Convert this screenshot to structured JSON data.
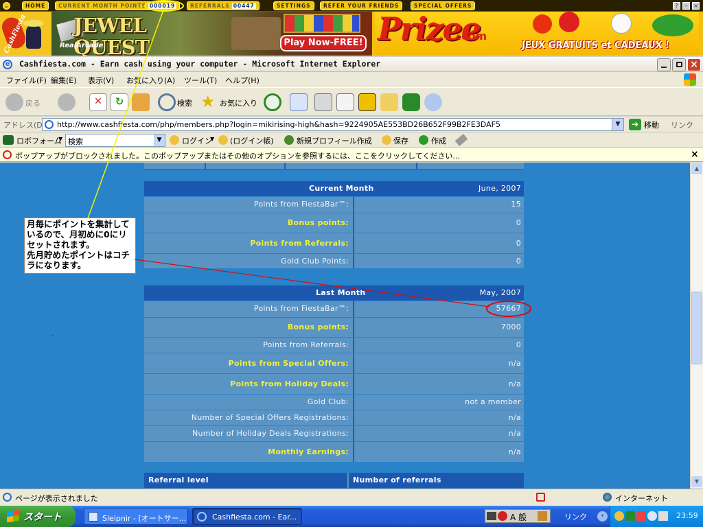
{
  "fiesta_bar": {
    "home": "HOME",
    "current_month_points_label": "CURRENT MONTH POINTS",
    "current_month_points_value": "000019",
    "referrals_label": "REFERRALS",
    "referrals_value": "00447",
    "settings": "SETTINGS",
    "refer_friends": "REFER YOUR FRIENDS",
    "special_offers": "SPECIAL OFFERS"
  },
  "ads": {
    "cashfiesta_logo": "CashFiesta",
    "jewel_quest": "JEWEL QUEST",
    "realarcade": "RealArcade",
    "play_now": "Play Now-FREE!",
    "prizee": "Prizee",
    "prizee_com": ".com",
    "prizee_tagline": "JEUX GRATUITS et CADEAUX !"
  },
  "browser": {
    "title": "Cashfiesta.com - Earn cash using your computer - Microsoft Internet Explorer",
    "menu": [
      "ファイル(F)",
      "編集(E)",
      "表示(V)",
      "お気に入り(A)",
      "ツール(T)",
      "ヘルプ(H)"
    ],
    "back": "戻る",
    "search": "検索",
    "favorites": "お気に入り",
    "address_label": "アドレス(D)",
    "url": "http://www.cashfiesta.com/php/members.php?login=mikirising-high&hash=9224905AE553BD26B652F99B2FE3DAF5",
    "go": "移動",
    "links": "リンク",
    "roboform": "ロボフォーム",
    "robo_search": "検索",
    "login": "ログイン",
    "login_book": "(ログイン帳)",
    "new_profile": "新規プロフィール作成",
    "save": "保存",
    "create": "作成",
    "popup_message": "ポップアップがブロックされました。このポップアップまたはその他のオプションを参照するには、ここをクリックしてください...",
    "status_text": "ページが表示されました",
    "zone": "インターネット"
  },
  "current_month": {
    "header": "Current Month",
    "date": "June, 2007",
    "rows": [
      {
        "label": "Points from FiestaBar™:",
        "value": "15"
      },
      {
        "label": "Bonus points:",
        "value": "0"
      },
      {
        "label": "Points from Referrals:",
        "value": "0"
      },
      {
        "label": "Gold Club Points:",
        "value": "0"
      }
    ]
  },
  "last_month": {
    "header": "Last Month",
    "date": "May, 2007",
    "rows": [
      {
        "label": "Points from FiestaBar™:",
        "value": "57667"
      },
      {
        "label": "Bonus points:",
        "value": "7000"
      },
      {
        "label": "Points from Referrals:",
        "value": "0"
      },
      {
        "label": "Points from Special Offers:",
        "value": "n/a"
      },
      {
        "label": "Points from Holiday Deals:",
        "value": "n/a"
      },
      {
        "label": "Gold Club:",
        "value": "not a member"
      },
      {
        "label": "Number of Special Offers Registrations:",
        "value": "n/a"
      },
      {
        "label": "Number of Holiday Deals Registrations:",
        "value": "n/a"
      },
      {
        "label": "Monthly Earnings:",
        "value": "n/a"
      }
    ]
  },
  "referral_table": {
    "col1": "Referral level",
    "col2": "Number of referrals"
  },
  "annotation": "月毎にポイントを集計しているので、月初めに0にリセットされます。\n先月貯めたポイントはコチラになります。",
  "taskbar": {
    "start": "スタート",
    "task1": "Sleipnir - [オートサー...",
    "task2": "Cashfiesta.com - Ear...",
    "ime": "A 般",
    "links": "リンク",
    "clock": "23:59"
  },
  "colors": {
    "page_bg": "#2a82c8",
    "row_bg": "#5a94c4",
    "header_bg": "#1c58b0",
    "highlight_text": "#f2ef3a",
    "fiestabar_bg": "#f2c810"
  }
}
